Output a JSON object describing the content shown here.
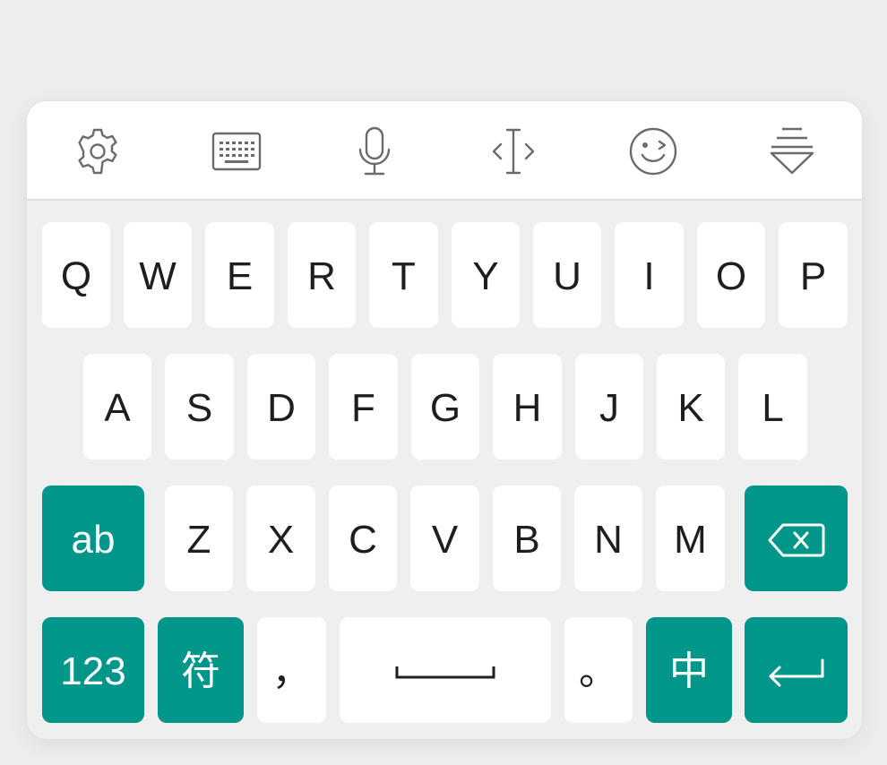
{
  "toolbar": {
    "items": [
      {
        "icon": "gear-icon"
      },
      {
        "icon": "keyboard-icon"
      },
      {
        "icon": "microphone-icon"
      },
      {
        "icon": "text-cursor-icon"
      },
      {
        "icon": "wink-emoji-icon"
      },
      {
        "icon": "collapse-keyboard-icon"
      }
    ]
  },
  "keys": {
    "row1": [
      "Q",
      "W",
      "E",
      "R",
      "T",
      "Y",
      "U",
      "I",
      "O",
      "P"
    ],
    "row2": [
      "A",
      "S",
      "D",
      "F",
      "G",
      "H",
      "J",
      "K",
      "L"
    ],
    "row3": {
      "shift": "ab",
      "letters": [
        "Z",
        "X",
        "C",
        "V",
        "B",
        "N",
        "M"
      ],
      "backspace_icon": "backspace-icon"
    },
    "row4": {
      "numbers": "123",
      "symbols": "符",
      "comma": "，",
      "space_icon": "space-bar-icon",
      "period": "。",
      "language": "中",
      "enter_icon": "enter-icon"
    }
  },
  "colors": {
    "accent": "#00968a",
    "key": "#ffffff",
    "background": "#efefef",
    "icon": "#6b6b6b",
    "text": "#1e1e1e"
  }
}
